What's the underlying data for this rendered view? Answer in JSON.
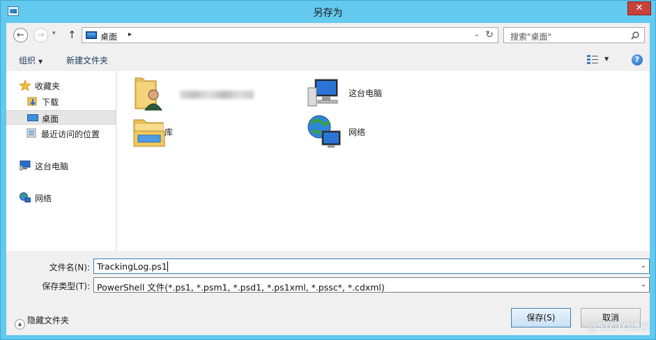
{
  "window": {
    "title": "另存为",
    "close_glyph": "✕"
  },
  "address_bar": {
    "path": "桌面",
    "separator": "▸",
    "dropdown_glyph": "⌄",
    "refresh_glyph": "↻"
  },
  "nav_buttons": {
    "back": "←",
    "forward": "→",
    "recent": "▾",
    "up": "↑"
  },
  "search": {
    "placeholder": "搜索\"桌面\""
  },
  "toolbar": {
    "organize": "组织",
    "new_folder": "新建文件夹",
    "help": "?"
  },
  "nav_pane": {
    "favorites": "收藏夹",
    "items": [
      {
        "label": "下载"
      },
      {
        "label": "桌面"
      },
      {
        "label": "最近访问的位置"
      }
    ],
    "this_pc": "这台电脑",
    "network": "网络"
  },
  "content": {
    "items": [
      {
        "label": ""
      },
      {
        "label": "这台电脑"
      },
      {
        "label": "库"
      },
      {
        "label": "网络"
      }
    ]
  },
  "form": {
    "filename_label": "文件名(N):",
    "filename_value": "TrackingLog.ps1",
    "filetype_label": "保存类型(T):",
    "filetype_value": "PowerShell 文件(*.ps1, *.psm1, *.psd1, *.ps1xml, *.pssc*, *.cdxml)"
  },
  "footer": {
    "hide_folders": "隐藏文件夹",
    "save": "保存(S)",
    "cancel": "取消"
  },
  "watermark": "@51CTO博客",
  "colors": {
    "frame": "#63c9ef",
    "close_button": "#c7423c",
    "primary_button_border": "#3c7fb1"
  }
}
